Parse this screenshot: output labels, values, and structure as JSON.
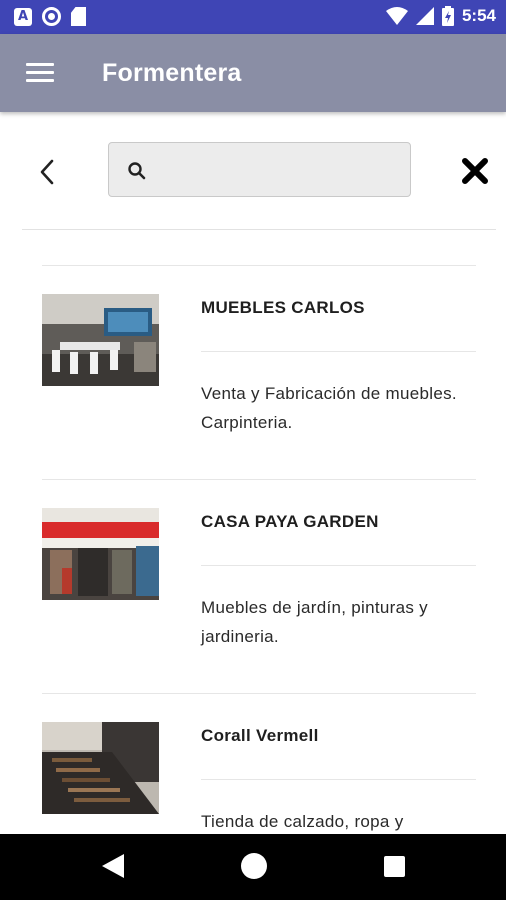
{
  "status_bar": {
    "time": "5:54"
  },
  "app_bar": {
    "title": "Formentera"
  },
  "search": {
    "placeholder": "",
    "value": ""
  },
  "items": [
    {
      "title": "MUEBLES CARLOS",
      "description": "Venta y Fabricación de muebles. Carpinteria."
    },
    {
      "title": "CASA PAYA GARDEN",
      "description": "Muebles de jardín, pinturas y jardineria."
    },
    {
      "title": "Corall Vermell",
      "description": "Tienda de calzado, ropa y"
    }
  ]
}
